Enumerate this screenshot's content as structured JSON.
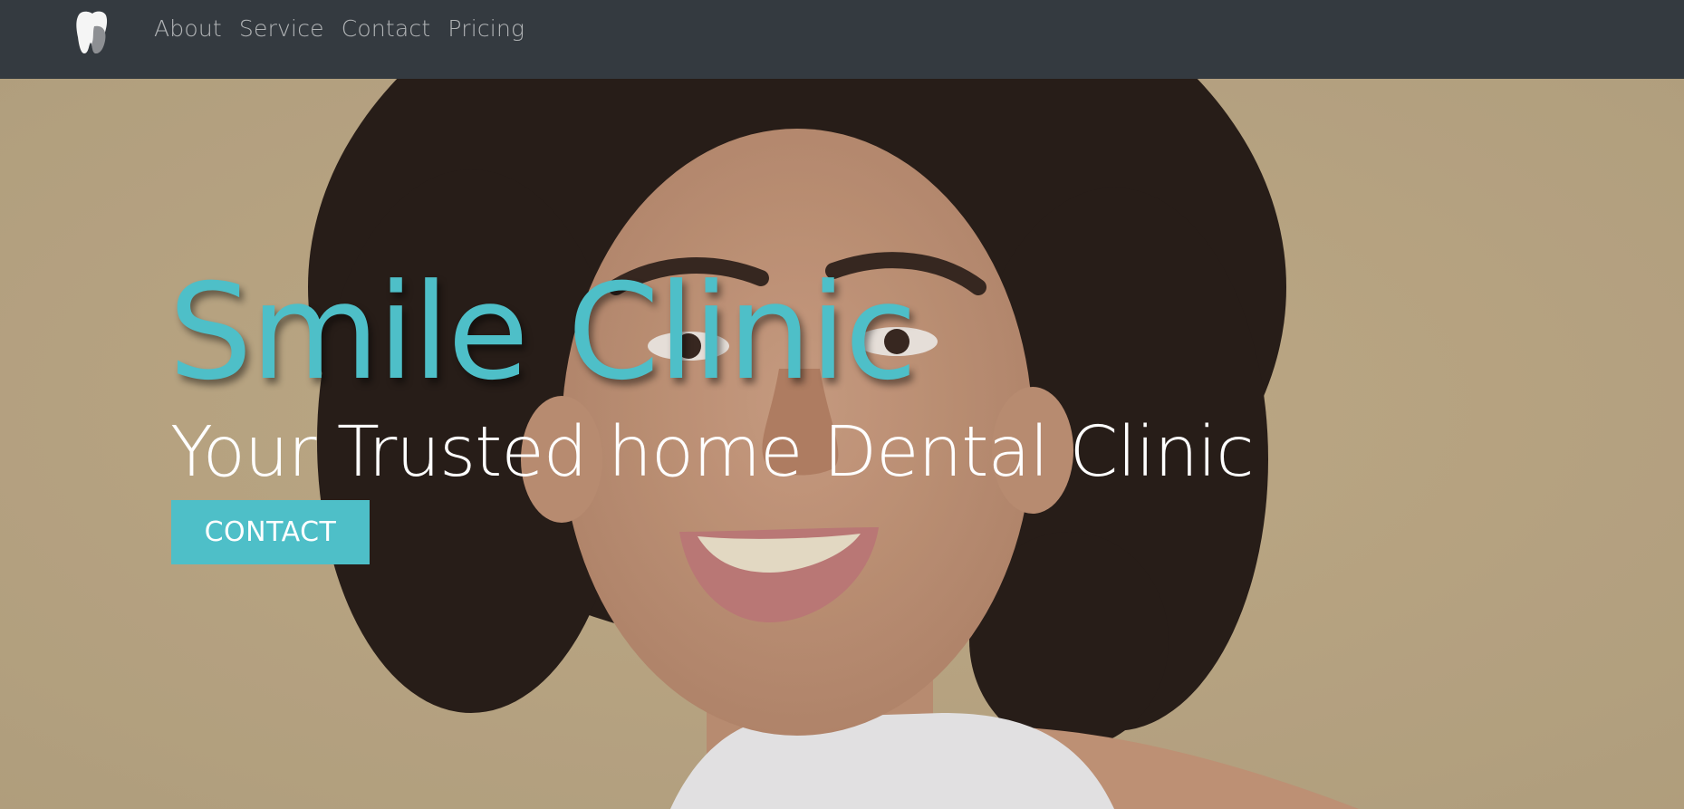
{
  "nav": {
    "logo_icon": "tooth-icon",
    "links": [
      {
        "label": "About"
      },
      {
        "label": "Service"
      },
      {
        "label": "Contact"
      },
      {
        "label": "Pricing"
      }
    ]
  },
  "hero": {
    "title": "Smile Clinic",
    "subtitle": "Your Trusted home Dental Clinic",
    "button_label": "CONTACT",
    "background_image": "smiling-woman-photo"
  },
  "colors": {
    "navbar": "#343a40",
    "accent": "#4ebfc8",
    "hero_background": "#c4b08a"
  }
}
